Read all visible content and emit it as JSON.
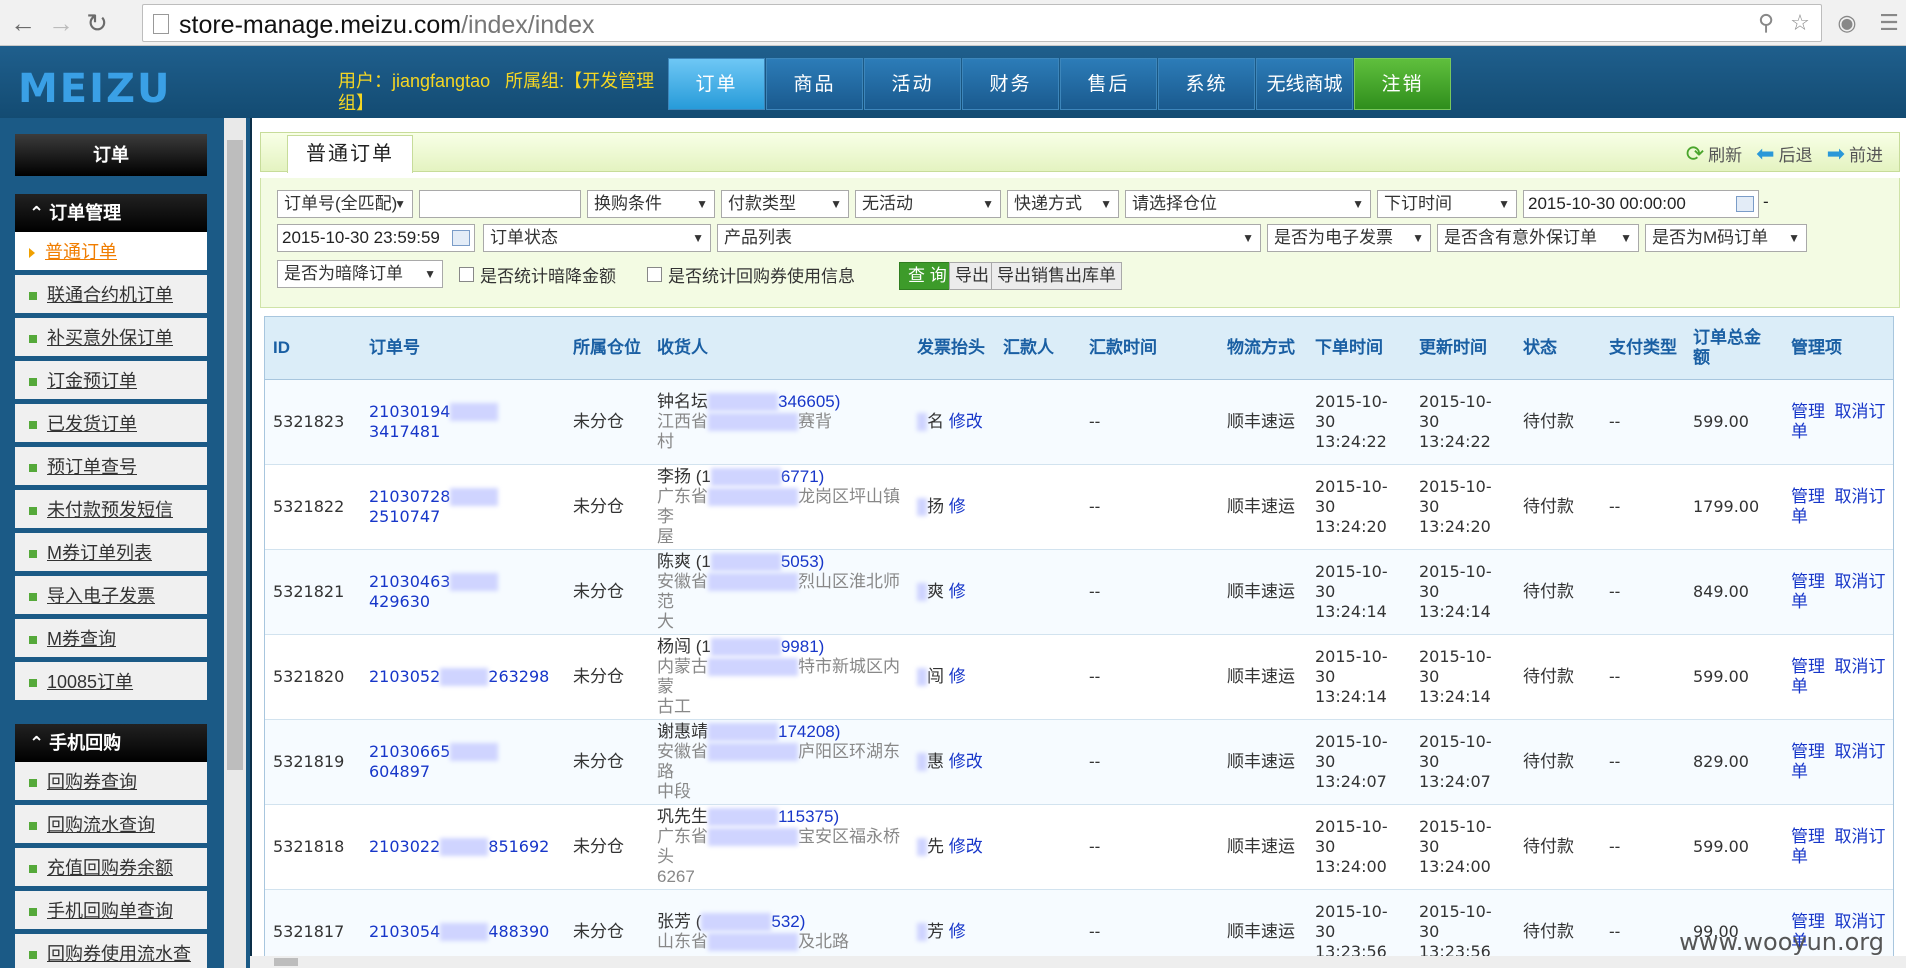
{
  "browser": {
    "url_host": "store-manage.meizu.com",
    "url_path": "/index/index"
  },
  "header": {
    "logo": "MEIZU",
    "user_label": "用户：jiangfangtao",
    "group_label": "所属组:【开发管理组】",
    "menu": [
      "订单",
      "商品",
      "活动",
      "财务",
      "售后",
      "系统",
      "无线商城",
      "注销"
    ]
  },
  "sidebar": {
    "top_button": "订单",
    "group1": "订单管理",
    "group1_items": [
      "普通订单",
      "联通合约机订单",
      "补买意外保订单",
      "订金预订单",
      "已发货订单",
      "预订单查号",
      "未付款预发短信",
      "M券订单列表",
      "导入电子发票",
      "M券查询",
      "10085订单"
    ],
    "group2": "手机回购",
    "group2_items": [
      "回购券查询",
      "回购流水查询",
      "充值回购券余额",
      "手机回购单查询",
      "回购券使用流水查"
    ]
  },
  "main": {
    "tab": "普通订单",
    "actions": {
      "refresh": "刷新",
      "back": "后退",
      "forward": "前进"
    },
    "filters": {
      "order_no_type": "订单号(全匹配)",
      "order_no_value": "",
      "swap_condition": "换购条件",
      "pay_type": "付款类型",
      "activity": "无活动",
      "express": "快递方式",
      "warehouse": "请选择仓位",
      "time_type": "下订时间",
      "start_time": "2015-10-30 00:00:00",
      "range_sep": "-",
      "end_time": "2015-10-30 23:59:59",
      "order_status": "订单状态",
      "product_list": "产品列表",
      "e_invoice": "是否为电子发票",
      "accident_insurance": "是否含有意外保订单",
      "mcode": "是否为M码订单",
      "dark_discount": "是否为暗降订单",
      "stat_dark_amount": "是否统计暗降金额",
      "stat_coupon": "是否统计回购券使用信息",
      "btn_query": "查 询",
      "btn_export": "导出",
      "btn_export_sales": "导出销售出库单"
    },
    "columns": [
      "ID",
      "订单号",
      "所属仓位",
      "收货人",
      "发票抬头",
      "汇款人",
      "汇款时间",
      "物流方式",
      "下单时间",
      "更新时间",
      "状态",
      "支付类型",
      "订单总金额",
      "管理项"
    ],
    "rows": [
      {
        "id": "5321823",
        "order_a": "21030194",
        "order_b": "3417481",
        "warehouse": "未分仓",
        "name": "钟名坛",
        "phone": "346605)",
        "addr_a": "江西省",
        "addr_b": "赛背",
        "addr_c": "村",
        "invoice": "名",
        "invoice_edit": "修改",
        "remitter": "",
        "remit_time": "--",
        "logistics": "顺丰速运",
        "created": "2015-10-30 13:24:22",
        "updated": "2015-10-30 13:24:22",
        "status": "待付款",
        "pay_type": "--",
        "total": "599.00"
      },
      {
        "id": "5321822",
        "order_a": "21030728",
        "order_b": "2510747",
        "warehouse": "未分仓",
        "name": "李扬 (1",
        "phone": "6771)",
        "addr_a": "广东省",
        "addr_b": "龙岗区坪山镇李",
        "addr_c": "屋",
        "invoice": "扬",
        "invoice_edit": "修",
        "remitter": "",
        "remit_time": "--",
        "logistics": "顺丰速运",
        "created": "2015-10-30 13:24:20",
        "updated": "2015-10-30 13:24:20",
        "status": "待付款",
        "pay_type": "--",
        "total": "1799.00"
      },
      {
        "id": "5321821",
        "order_a": "21030463",
        "order_b": "429630",
        "warehouse": "未分仓",
        "name": "陈爽 (1",
        "phone": "5053)",
        "addr_a": "安徽省",
        "addr_b": "烈山区淮北师范",
        "addr_c": "大",
        "invoice": "爽",
        "invoice_edit": "修",
        "remitter": "",
        "remit_time": "--",
        "logistics": "顺丰速运",
        "created": "2015-10-30 13:24:14",
        "updated": "2015-10-30 13:24:14",
        "status": "待付款",
        "pay_type": "--",
        "total": "849.00"
      },
      {
        "id": "5321820",
        "order_a": "2103052",
        "order_b": "263298",
        "warehouse": "未分仓",
        "name": "杨闯 (1",
        "phone": "9981)",
        "addr_a": "内蒙古",
        "addr_b": "特市新城区内蒙",
        "addr_c": "古工",
        "invoice": "闯",
        "invoice_edit": "修",
        "remitter": "",
        "remit_time": "--",
        "logistics": "顺丰速运",
        "created": "2015-10-30 13:24:14",
        "updated": "2015-10-30 13:24:14",
        "status": "待付款",
        "pay_type": "--",
        "total": "599.00"
      },
      {
        "id": "5321819",
        "order_a": "21030665",
        "order_b": "604897",
        "warehouse": "未分仓",
        "name": "谢惠靖",
        "phone": "174208)",
        "addr_a": "安徽省",
        "addr_b": "庐阳区环湖东路",
        "addr_c": "中段",
        "invoice": "惠",
        "invoice_edit": "修改",
        "remitter": "",
        "remit_time": "--",
        "logistics": "顺丰速运",
        "created": "2015-10-30 13:24:07",
        "updated": "2015-10-30 13:24:07",
        "status": "待付款",
        "pay_type": "--",
        "total": "829.00"
      },
      {
        "id": "5321818",
        "order_a": "2103022",
        "order_b": "851692",
        "warehouse": "未分仓",
        "name": "巩先生",
        "phone": "115375)",
        "addr_a": "广东省",
        "addr_b": "宝安区福永桥头",
        "addr_c": "6267",
        "invoice": "先",
        "invoice_edit": "修改",
        "remitter": "",
        "remit_time": "--",
        "logistics": "顺丰速运",
        "created": "2015-10-30 13:24:00",
        "updated": "2015-10-30 13:24:00",
        "status": "待付款",
        "pay_type": "--",
        "total": "599.00"
      },
      {
        "id": "5321817",
        "order_a": "2103054",
        "order_b": "488390",
        "warehouse": "未分仓",
        "name": "张芳 (",
        "phone": "532)",
        "addr_a": "山东省",
        "addr_b": "及北路",
        "addr_c": "",
        "invoice": "芳",
        "invoice_edit": "修",
        "remitter": "",
        "remit_time": "--",
        "logistics": "顺丰速运",
        "created": "2015-10-30 13:23:56",
        "updated": "2015-10-30 13:23:56",
        "status": "待付款",
        "pay_type": "--",
        "total": "99.00"
      }
    ],
    "row_actions": {
      "manage": "管理",
      "cancel": "取消订单"
    }
  },
  "watermark": "www.wooyun.org"
}
